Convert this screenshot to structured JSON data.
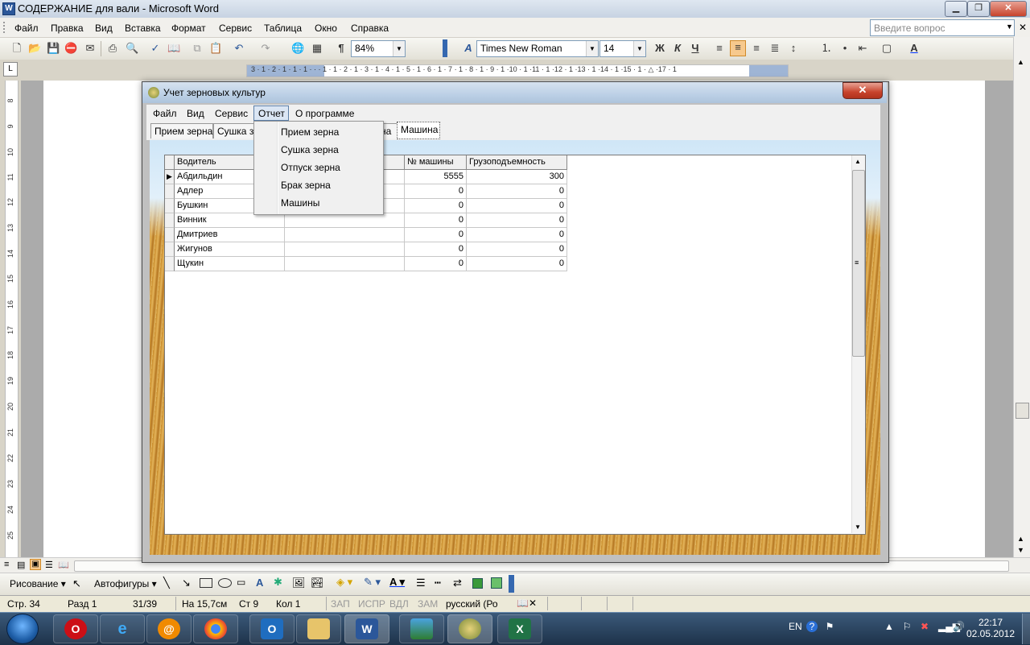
{
  "word": {
    "title": "СОДЕРЖАНИЕ для вали - Microsoft Word",
    "menu": [
      "Файл",
      "Правка",
      "Вид",
      "Вставка",
      "Формат",
      "Сервис",
      "Таблица",
      "Окно",
      "Справка"
    ],
    "ask_placeholder": "Введите вопрос",
    "zoom": "84%",
    "font": "Times New Roman",
    "font_size": "14",
    "ruler_text": "3 · 1 · 2 · 1 · 1 · 1 · · · 1 · 1 · 2 · 1 · 3 · 1 · 4 · 1 · 5 · 1 · 6 · 1 · 7 · 1 · 8 · 1 · 9 · 1 ·10 · 1 ·11 · 1 ·12 · 1 ·13 · 1 ·14 · 1 ·15 · 1 · △ ·17 · 1",
    "vruler_numbers": [
      "8",
      "9",
      "10",
      "11",
      "12",
      "13",
      "14",
      "15",
      "16",
      "17",
      "18",
      "19",
      "20",
      "21",
      "22",
      "23",
      "24",
      "25"
    ],
    "drawing_label": "Рисование",
    "autoshapes_label": "Автофигуры",
    "status": {
      "page": "Стр. 34",
      "section": "Разд 1",
      "pages": "31/39",
      "at": "На 15,7см",
      "line": "Ст 9",
      "col": "Кол 1",
      "rec": "ЗАП",
      "trk": "ИСПР",
      "ext": "ВДЛ",
      "ovr": "ЗАМ",
      "lang": "русский (Ро"
    }
  },
  "app": {
    "title": "Учет зерновых культур",
    "menu": [
      "Файл",
      "Вид",
      "Сервис",
      "Отчет",
      "О программе"
    ],
    "tabs": [
      "Прием зерна",
      "Сушка зе",
      "на",
      "Машина"
    ],
    "report_menu": [
      "Прием зерна",
      "Сушка зерна",
      "Отпуск зерна",
      "Брак зерна",
      "Машины"
    ],
    "grid": {
      "headers": [
        "Водитель",
        "",
        "№ машины",
        "Грузоподъемность"
      ],
      "rows": [
        [
          "Абдильдин",
          "",
          "5555",
          "300"
        ],
        [
          "Адлер",
          "",
          "0",
          "0"
        ],
        [
          "Бушкин",
          "",
          "0",
          "0"
        ],
        [
          "Винник",
          "",
          "0",
          "0"
        ],
        [
          "Дмитриев",
          "",
          "0",
          "0"
        ],
        [
          "Жигунов",
          "",
          "0",
          "0"
        ],
        [
          "Щукин",
          "",
          "0",
          "0"
        ]
      ]
    }
  },
  "taskbar": {
    "lang": "EN",
    "time": "22:17",
    "date": "02.05.2012"
  }
}
